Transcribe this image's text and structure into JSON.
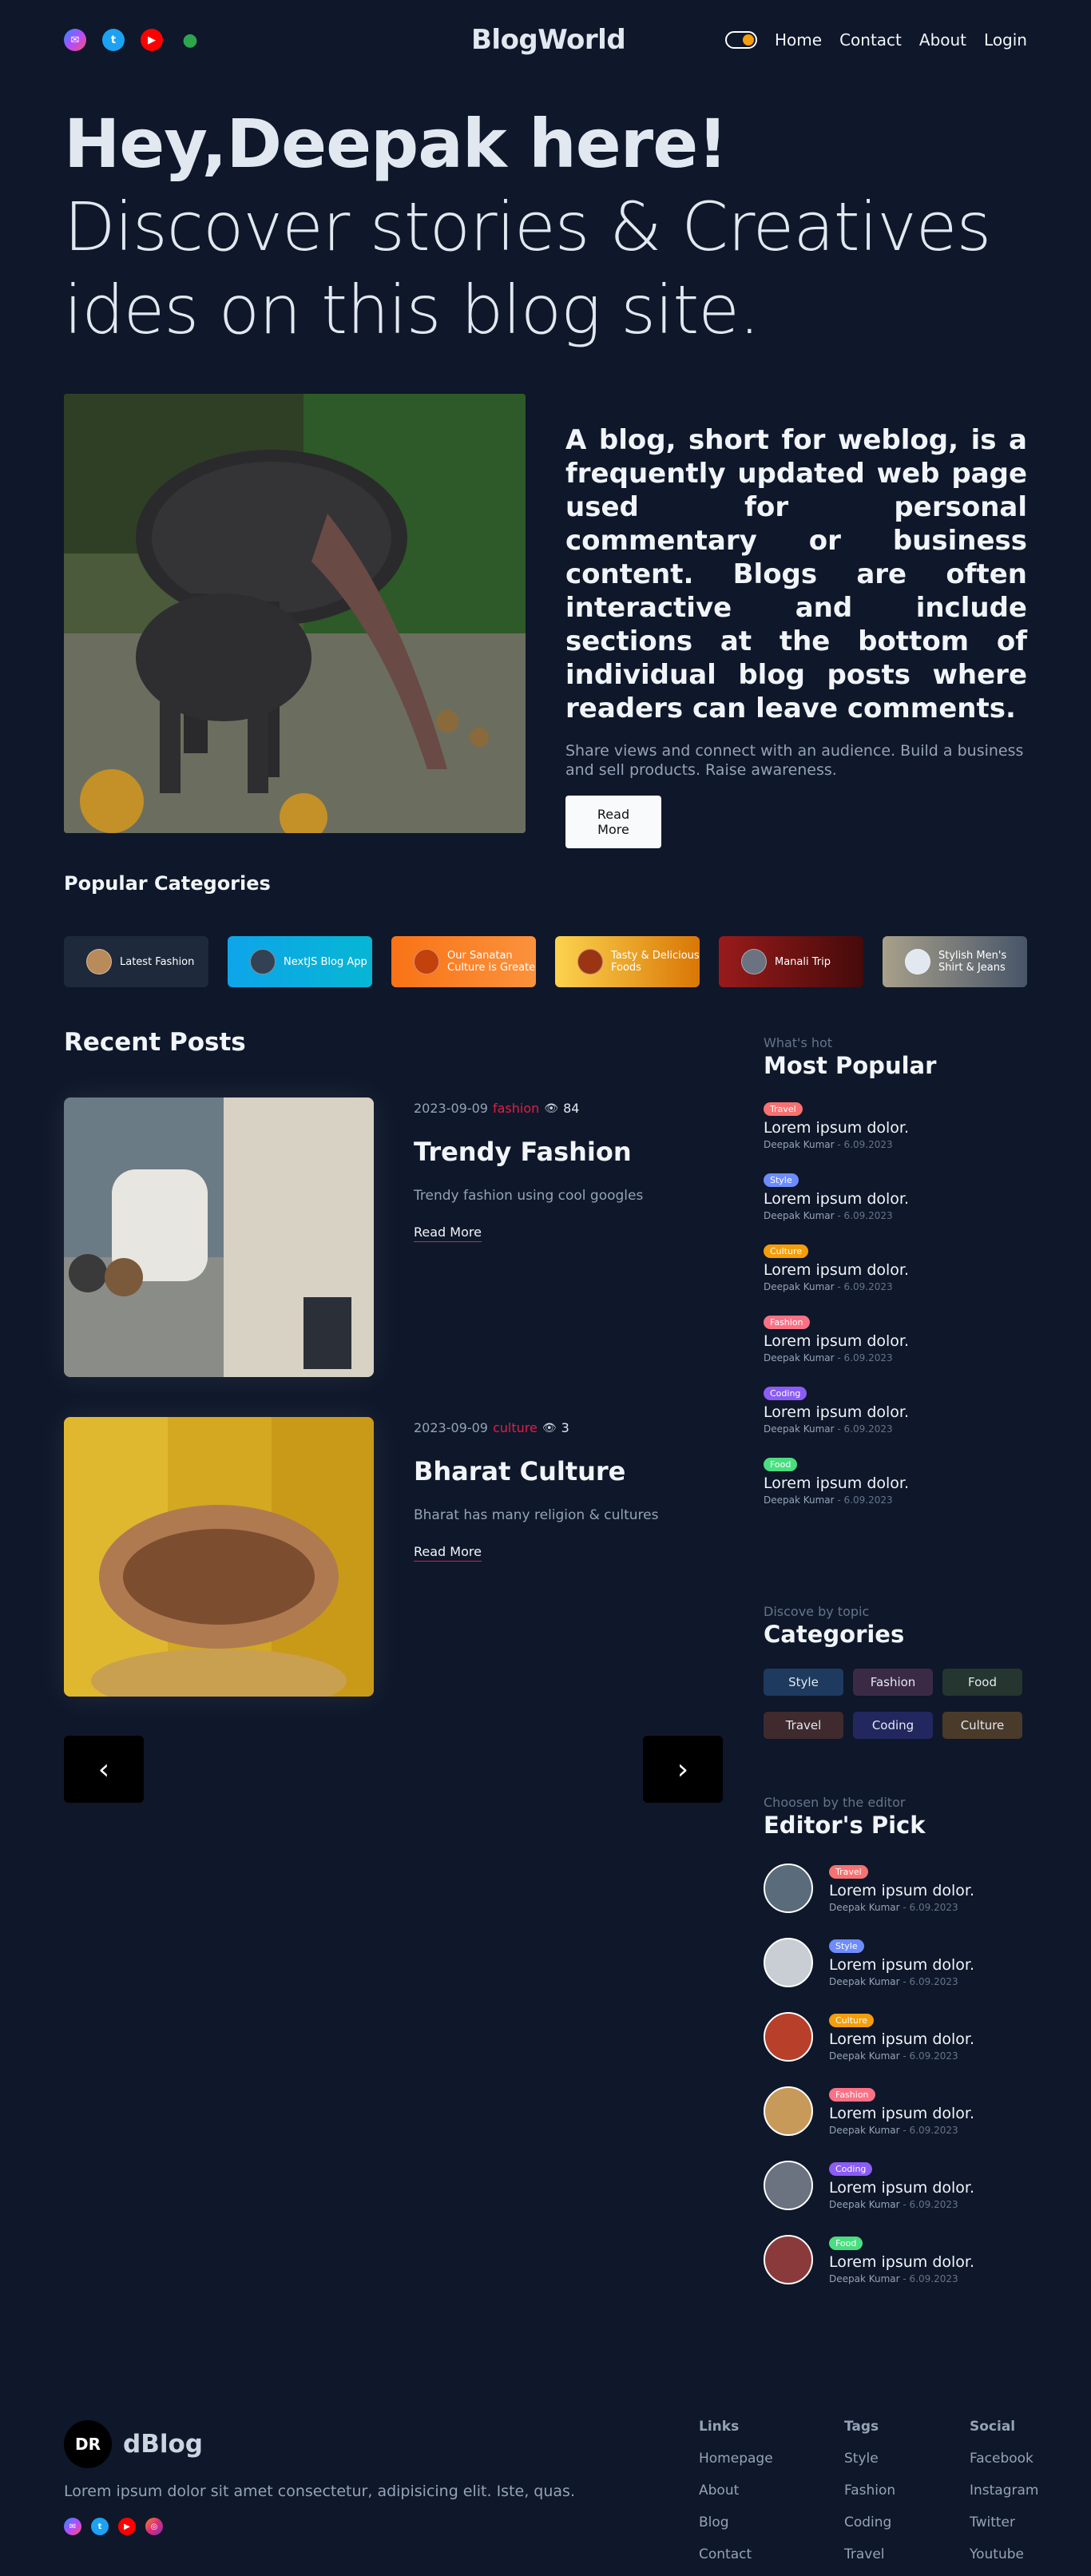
{
  "header": {
    "brand": "BlogWorld",
    "nav": [
      "Home",
      "Contact",
      "About",
      "Login"
    ]
  },
  "hero": {
    "title_bold": "Hey,Deepak here!",
    "title_rest": " Discover stories & Creatives ides on this blog site.",
    "lead": "A blog, short for weblog, is a frequently updated web page used for personal commentary or business content. Blogs are often interactive and include sections at the bottom of individual blog posts where readers can leave comments.",
    "sub": "Share views and connect with an audience. Build a business and sell products. Raise awareness.",
    "cta": "Read More"
  },
  "popular_categories": {
    "title": "Popular Categories",
    "items": [
      {
        "label": "Latest Fashion",
        "bg": "#1e293b"
      },
      {
        "label": "NextJS Blog App",
        "bg": "#0ea5e9"
      },
      {
        "label": "Our Sanatan Culture is Greate",
        "bg": "#f97316"
      },
      {
        "label": "Tasty & Delicious Foods",
        "bg": "#f59e0b"
      },
      {
        "label": "Manali Trip",
        "bg": "#7f1d1d"
      },
      {
        "label": "Stylish Men's Shirt & Jeans",
        "bg": "#64748b"
      }
    ]
  },
  "recent_posts": {
    "title": "Recent Posts",
    "items": [
      {
        "date": "2023-09-09",
        "tag": "fashion",
        "views": "84",
        "title": "Trendy Fashion",
        "desc": "Trendy fashion using cool googles",
        "link": "Read More"
      },
      {
        "date": "2023-09-09",
        "tag": "culture",
        "views": "3",
        "title": "Bharat Culture",
        "desc": "Bharat has many religion & cultures",
        "link": "Read More"
      }
    ],
    "prev": "‹",
    "next": "›"
  },
  "most_popular": {
    "kicker": "What's hot",
    "title": "Most Popular",
    "items": [
      {
        "badge": "Travel",
        "color": "#f87171",
        "title": "Lorem ipsum dolor.",
        "author": "Deepak Kumar",
        "date": " - 6.09.2023"
      },
      {
        "badge": "Style",
        "color": "#6d8cff",
        "title": "Lorem ipsum dolor.",
        "author": "Deepak Kumar",
        "date": " - 6.09.2023"
      },
      {
        "badge": "Culture",
        "color": "#f59e0b",
        "title": "Lorem ipsum dolor.",
        "author": "Deepak Kumar",
        "date": " - 6.09.2023"
      },
      {
        "badge": "Fashion",
        "color": "#fb7185",
        "title": "Lorem ipsum dolor.",
        "author": "Deepak Kumar",
        "date": " - 6.09.2023"
      },
      {
        "badge": "Coding",
        "color": "#8b5cf6",
        "title": "Lorem ipsum dolor.",
        "author": "Deepak Kumar",
        "date": " - 6.09.2023"
      },
      {
        "badge": "Food",
        "color": "#4ade80",
        "title": "Lorem ipsum dolor.",
        "author": "Deepak Kumar",
        "date": " - 6.09.2023"
      }
    ]
  },
  "categories": {
    "kicker": "Discove by topic",
    "title": "Categories",
    "items": [
      {
        "label": "Style",
        "bg": "#1e3a5f"
      },
      {
        "label": "Fashion",
        "bg": "#3b2a45"
      },
      {
        "label": "Food",
        "bg": "#25352f"
      },
      {
        "label": "Travel",
        "bg": "#3f2a2e"
      },
      {
        "label": "Coding",
        "bg": "#23275f"
      },
      {
        "label": "Culture",
        "bg": "#4a3a2a"
      }
    ]
  },
  "editors_pick": {
    "kicker": "Choosen by the editor",
    "title": "Editor's Pick",
    "items": [
      {
        "badge": "Travel",
        "color": "#f87171",
        "title": "Lorem ipsum dolor.",
        "author": "Deepak Kumar",
        "date": " - 6.09.2023",
        "av": "#5a6b7c"
      },
      {
        "badge": "Style",
        "color": "#6d8cff",
        "title": "Lorem ipsum dolor.",
        "author": "Deepak Kumar",
        "date": " - 6.09.2023",
        "av": "#c9ced4"
      },
      {
        "badge": "Culture",
        "color": "#f59e0b",
        "title": "Lorem ipsum dolor.",
        "author": "Deepak Kumar",
        "date": " - 6.09.2023",
        "av": "#b8402a"
      },
      {
        "badge": "Fashion",
        "color": "#fb7185",
        "title": "Lorem ipsum dolor.",
        "author": "Deepak Kumar",
        "date": " - 6.09.2023",
        "av": "#c89a5a"
      },
      {
        "badge": "Coding",
        "color": "#8b5cf6",
        "title": "Lorem ipsum dolor.",
        "author": "Deepak Kumar",
        "date": " - 6.09.2023",
        "av": "#6b7280"
      },
      {
        "badge": "Food",
        "color": "#4ade80",
        "title": "Lorem ipsum dolor.",
        "author": "Deepak Kumar",
        "date": " - 6.09.2023",
        "av": "#8a3a3a"
      }
    ]
  },
  "footer": {
    "logo_mark": "DR",
    "logo_text": "dBlog",
    "desc": "Lorem ipsum dolor sit amet consectetur, adipisicing elit. Iste, quas.",
    "links": {
      "title": "Links",
      "items": [
        "Homepage",
        "About",
        "Blog",
        "Contact"
      ]
    },
    "tags": {
      "title": "Tags",
      "items": [
        "Style",
        "Fashion",
        "Coding",
        "Travel"
      ]
    },
    "social": {
      "title": "Social",
      "items": [
        "Facebook",
        "Instagram",
        "Twitter",
        "Youtube"
      ]
    }
  }
}
